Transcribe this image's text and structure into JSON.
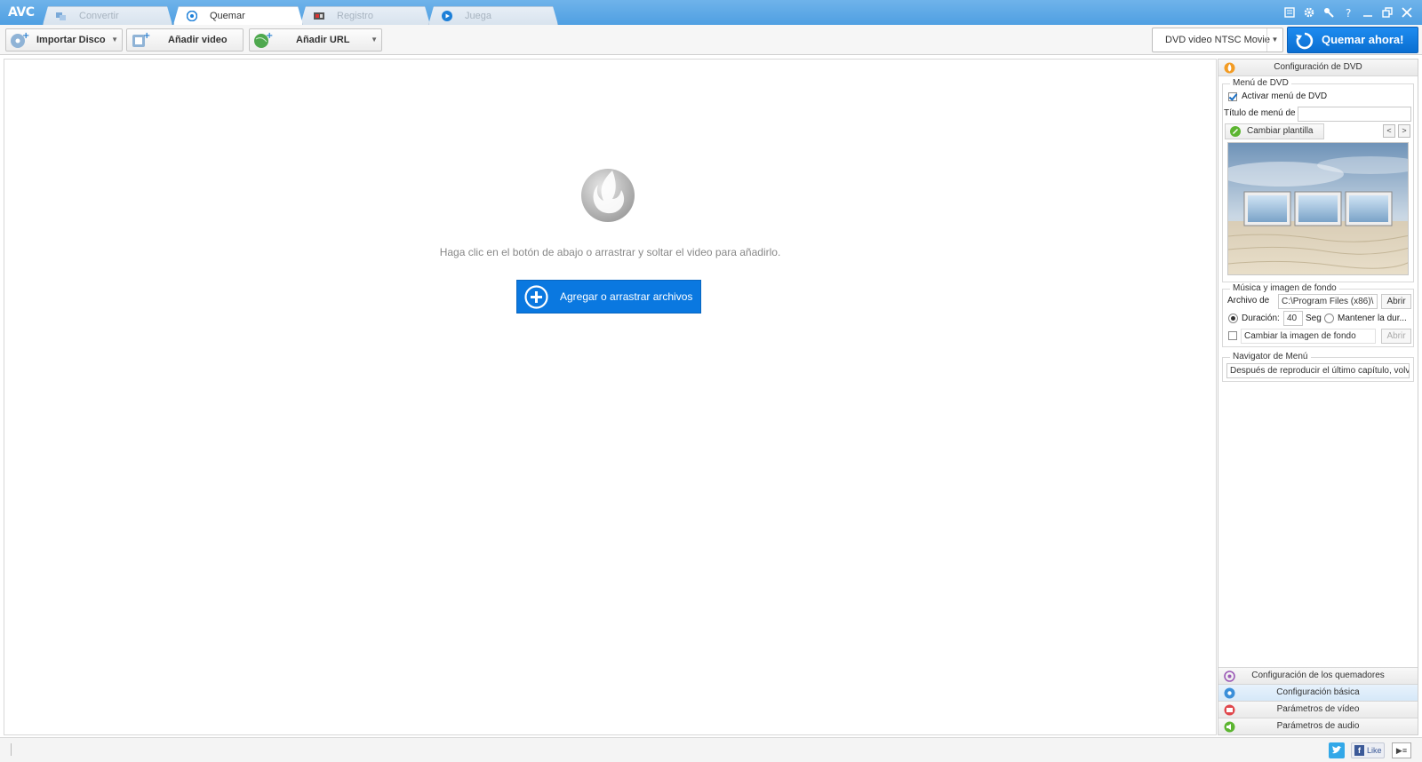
{
  "app": {
    "logo": "AVC"
  },
  "tabs": [
    {
      "label": "Convertir",
      "active": false,
      "icon": "convert-icon"
    },
    {
      "label": "Quemar",
      "active": true,
      "icon": "disc-icon"
    },
    {
      "label": "Registro",
      "active": false,
      "icon": "record-icon"
    },
    {
      "label": "Juega",
      "active": false,
      "icon": "play-icon"
    }
  ],
  "window_controls": [
    "menu-icon",
    "settings-icon",
    "tools-icon",
    "help-icon",
    "minimize-icon",
    "restore-icon",
    "close-icon"
  ],
  "toolbar": {
    "import_disc": "Importar Disco",
    "add_video": "Añadir video",
    "add_url": "Añadir URL",
    "profile": "DVD video NTSC Movie",
    "burn_now": "Quemar ahora!"
  },
  "main": {
    "hint": "Haga clic en el botón de abajo o arrastrar y soltar el video para añadirlo.",
    "add_files": "Agregar o arrastrar archivos"
  },
  "side": {
    "header": "Configuración de DVD",
    "dvd_menu": {
      "group_title": "Menú de DVD",
      "enable_label": "Activar menú de DVD",
      "enable_checked": true,
      "title_label": "Título de menú de",
      "title_value": "",
      "template_button": "Cambiar plantilla",
      "prev": "<",
      "next": ">"
    },
    "music": {
      "group_title": "Música y imagen de fondo",
      "file_label": "Archivo de",
      "file_value": "C:\\Program Files (x86)\\",
      "open_button": "Abrir",
      "duration_label": "Duración:",
      "duration_value": "40",
      "seg_label": "Seg",
      "keep_label": "Mantener la dur...",
      "duration_selected": true,
      "change_bg_label": "Cambiar la imagen de fondo",
      "change_bg_checked": false,
      "open_bg_button": "Abrir"
    },
    "navigator": {
      "group_title": "Navigator de Menú",
      "value": "Después de reproducir el último capítulo, volv"
    },
    "accordion": [
      {
        "label": "Configuración de los quemadores",
        "icon": "burner-settings-icon",
        "color": "#9b59b6"
      },
      {
        "label": "Configuración básica",
        "icon": "basic-settings-icon",
        "color": "#3b8fd9"
      },
      {
        "label": "Parámetros de vídeo",
        "icon": "video-params-icon",
        "color": "#e0474c"
      },
      {
        "label": "Parámetros de audio",
        "icon": "audio-params-icon",
        "color": "#5cb531"
      }
    ]
  },
  "status": {
    "fb_like": "Like"
  },
  "colors": {
    "titlebar": "#5aa8e6",
    "accent": "#0a78e0"
  }
}
